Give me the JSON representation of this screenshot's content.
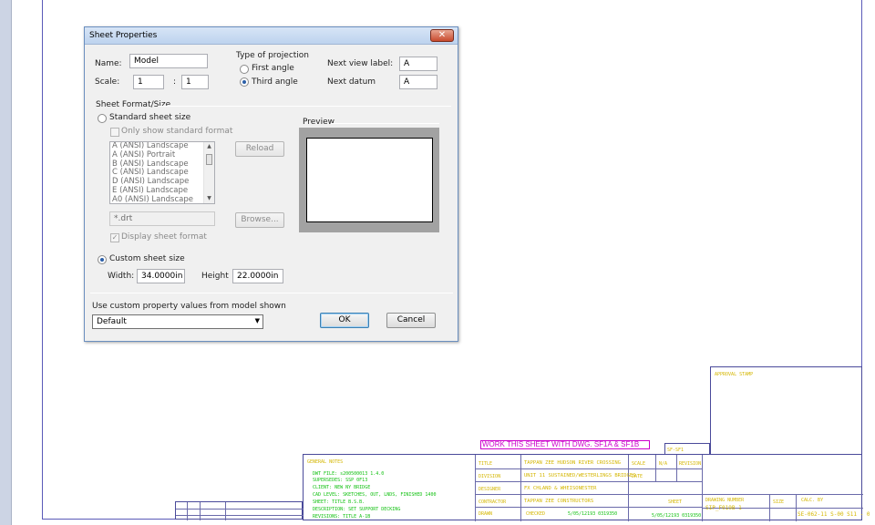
{
  "dialog": {
    "title": "Sheet Properties",
    "close_glyph": "✕",
    "name_label": "Name:",
    "name_value": "Model",
    "scale_label": "Scale:",
    "scale_numerator": "1",
    "scale_separator": ":",
    "scale_denominator": "1",
    "projection_group_label": "Type of projection",
    "projection_first": "First angle",
    "projection_third": "Third angle",
    "next_view_label": "Next view label:",
    "next_view_value": "A",
    "next_datum_label": "Next datum",
    "next_datum_value": "A",
    "sheet_format_group": "Sheet Format/Size",
    "standard_sheet_size": "Standard sheet size",
    "only_show_standard": "Only show standard format",
    "sheet_sizes": [
      "A (ANSI) Landscape",
      "A (ANSI) Portrait",
      "B (ANSI) Landscape",
      "C (ANSI) Landscape",
      "D (ANSI) Landscape",
      "E (ANSI) Landscape",
      "A0 (ANSI) Landscape"
    ],
    "reload_button": "Reload",
    "preview_label": "Preview",
    "template_file": "*.drt",
    "browse_button": "Browse...",
    "display_sheet_format": "Display sheet format",
    "custom_sheet_size": "Custom sheet size",
    "width_label": "Width:",
    "width_value": "34.0000in",
    "height_label": "Height",
    "height_value": "22.0000in",
    "use_custom_property_label": "Use custom property values from model shown",
    "model_select_value": "Default",
    "ok_button": "OK",
    "cancel_button": "Cancel"
  },
  "drawing": {
    "magenta_note": "WORK THIS SHEET WITH  DWG. SF1A & SF1B",
    "approvals_label": "APPROVAL STAMP",
    "general_notes_label": "GENERAL NOTES",
    "notes_lines": [
      "DWT FILE:          s200500013 1.4.0",
      "SUPERSEDES:      SSP 0F13",
      "CLIENT:   NEW NY BRIDGE",
      "CAD LEVEL:   SKETCHES, OUT, LNDS, FINISHED 1400",
      "SHEET:   TITLE B.S.B.",
      "DESCRIPTION:   SET SUPPORT DECKING",
      "REVISIONS:         TITLE A-1B"
    ],
    "title_rows": [
      {
        "key": "TITLE",
        "value": "TAPPAN ZEE HUDSON RIVER CROSSING"
      },
      {
        "key": "DIVISION",
        "value": "UNIT 11 SUSTAINED/WESTERLINGS BRIDGES"
      },
      {
        "key": "DESIGNER",
        "value": "FX CHLAND & WHEISONESTER"
      },
      {
        "key": "CONTRACTOR",
        "value": "TAPPAN ZEE CONSTRUCTORS"
      },
      {
        "key": "DRAWN",
        "value": "CHECKED"
      }
    ],
    "date_value": "5/05/12193 0319350",
    "sheet_code": "SIP_F019B 1",
    "doc_number": "SE-062-11 S-00 S11 - 0",
    "cell_sf": "SF-SF1",
    "small_labels": [
      "SCALE",
      "N/A",
      "REVISION",
      "DATE",
      "SHEET",
      "DRAWING NUMBER",
      "SIZE",
      "CALC. BY"
    ]
  }
}
